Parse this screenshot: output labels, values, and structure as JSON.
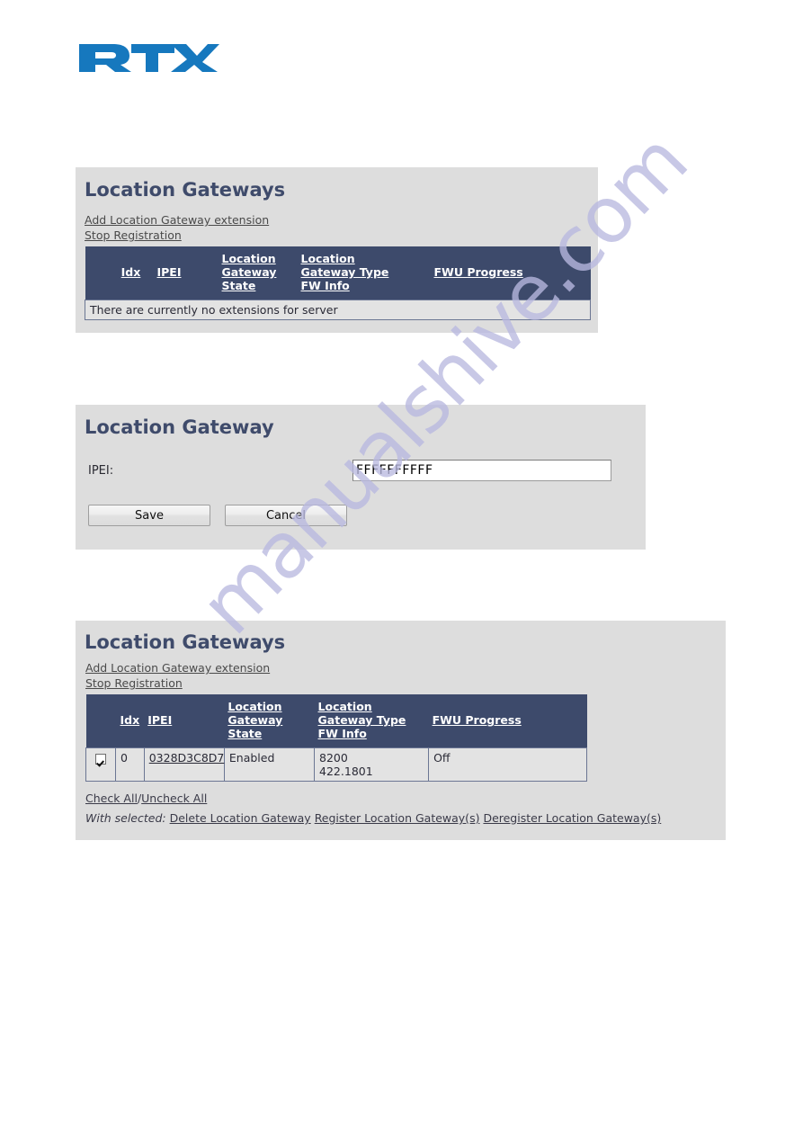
{
  "logo": {
    "brand": "RTX",
    "brand_color": "#1678be",
    "mark_color": "#1a5f9e"
  },
  "watermark": {
    "text": "manualshive.com",
    "color": "#b9b9e0"
  },
  "panel_empty": {
    "title": "Location Gateways",
    "links": [
      {
        "label": "Add Location Gateway extension"
      },
      {
        "label": "Stop Registration"
      }
    ],
    "columns": [
      {
        "label": ""
      },
      {
        "label": "Idx"
      },
      {
        "label": "IPEI"
      },
      {
        "label": "Location Gateway State",
        "lines": [
          "Location",
          "Gateway",
          "State"
        ]
      },
      {
        "label": "Location Gateway Type FW Info",
        "lines": [
          "Location",
          "Gateway Type",
          "FW Info"
        ]
      },
      {
        "label": "FWU Progress",
        "lines": [
          "FWU Progress"
        ]
      }
    ],
    "empty_message": "There are currently no extensions for server"
  },
  "panel_form": {
    "title": "Location Gateway",
    "ipei_label": "IPEI:",
    "ipei_value": "FFFFFFFFFF",
    "ipei_placeholder": "",
    "save_label": "Save",
    "cancel_label": "Cancel"
  },
  "panel_list": {
    "title": "Location Gateways",
    "links": [
      {
        "label": "Add Location Gateway extension"
      },
      {
        "label": "Stop Registration"
      }
    ],
    "columns": [
      {
        "label": ""
      },
      {
        "label": "Idx"
      },
      {
        "label": "IPEI"
      },
      {
        "label": "Location Gateway State",
        "lines": [
          "Location",
          "Gateway",
          "State"
        ]
      },
      {
        "label": "Location Gateway Type FW Info",
        "lines": [
          "Location",
          "Gateway Type",
          "FW Info"
        ]
      },
      {
        "label": "FWU Progress",
        "lines": [
          "FWU Progress"
        ]
      }
    ],
    "rows": [
      {
        "selected": true,
        "idx": "0",
        "ipei": "0328D3C8D7",
        "state": "Enabled",
        "type": "8200",
        "fw_info": "422.1801",
        "fwu_progress": "Off"
      }
    ],
    "check_all_label": "Check All",
    "separator": "/",
    "uncheck_all_label": "Uncheck All",
    "with_selected_label": "With selected:",
    "actions": [
      {
        "label": "Delete Location Gateway"
      },
      {
        "label": "Register Location Gateway(s)"
      },
      {
        "label": "Deregister Location Gateway(s)"
      }
    ]
  },
  "colors": {
    "panel_bg": "#dddddd",
    "table_header_bg": "#3d4a6b",
    "table_row_bg": "#e3e3e3",
    "title_text": "#3f4b6b",
    "cell_border": "#6b7693"
  }
}
